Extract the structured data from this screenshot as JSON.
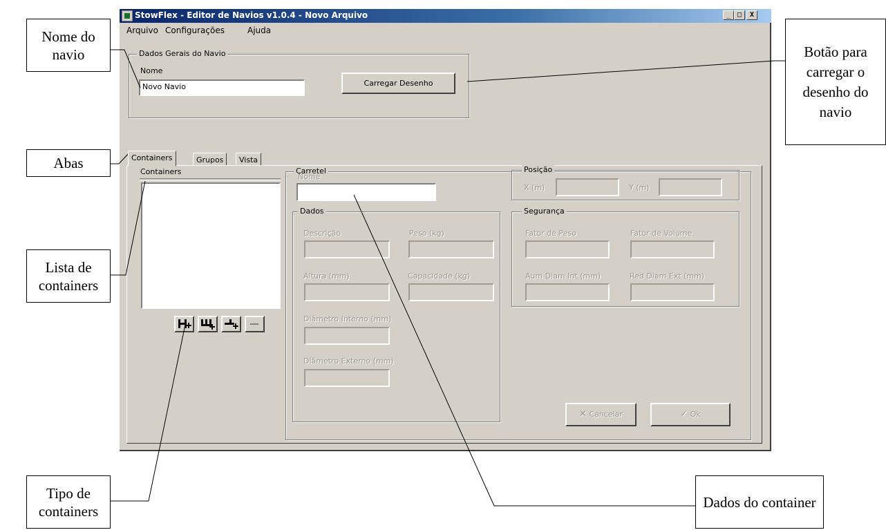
{
  "window": {
    "title": "StowFlex - Editor de Navios v1.0.4 - Novo Arquivo",
    "controls": [
      "_",
      "□",
      "X"
    ]
  },
  "menu": [
    "Arquivo",
    "Configurações",
    "Ajuda"
  ],
  "dados_gerais": {
    "legend": "Dados Gerais do Navio",
    "nome_label": "Nome",
    "nome_value": "Novo Navio",
    "carregar_button": "Carregar Desenho"
  },
  "tabs": [
    "Containers",
    "Grupos",
    "Vista"
  ],
  "containers_panel": {
    "label": "Containers",
    "toolbar_icons": [
      "add-container-type-1-icon",
      "add-container-type-2-icon",
      "add-container-type-3-icon",
      "remove-icon"
    ]
  },
  "carretel": {
    "legend": "Carretel",
    "nome_label": "Nome"
  },
  "dados": {
    "legend": "Dados",
    "descricao": "Descrição",
    "peso": "Peso (kg)",
    "altura": "Altura (mm)",
    "capacidade": "Capacidade (kg)",
    "diametro_interno": "Diâmetro Interno (mm)",
    "diametro_externo": "Diâmetro Externo (mm)"
  },
  "posicao": {
    "legend": "Posição",
    "x_label": "X (m)",
    "y_label": "Y (m)"
  },
  "seguranca": {
    "legend": "Segurança",
    "fator_peso": "Fator de Peso",
    "fator_volume": "Fator de Volume",
    "aum_diam_int": "Aum Diam Int (mm)",
    "red_diam_ext": "Red Diam Ext (mm)"
  },
  "buttons": {
    "cancelar": "Cancelar",
    "ok": "Ok"
  },
  "callouts": {
    "nome_navio": "Nome do navio",
    "botao_carregar": "Botão para carregar o desenho do navio",
    "abas": "Abas",
    "lista_containers": "Lista de containers",
    "tipo_containers": "Tipo de containers",
    "dados_container": "Dados do container"
  }
}
